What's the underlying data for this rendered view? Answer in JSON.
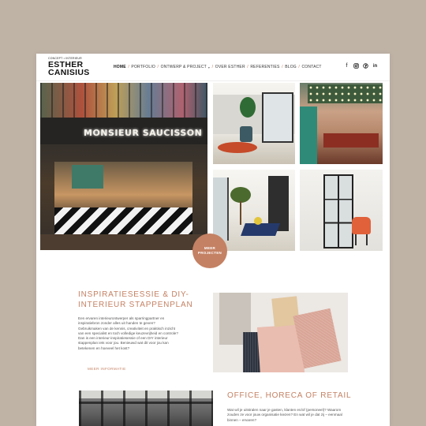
{
  "header": {
    "logo_tagline": "CONCEPT • INTERIEUR",
    "logo_line1": "ESTHER",
    "logo_line2": "CANISIUS",
    "nav": [
      {
        "label": "Home",
        "active": true
      },
      {
        "label": "Portfolio"
      },
      {
        "label": "Ontwerp & Project",
        "has_dropdown": true
      },
      {
        "label": "Over Esther"
      },
      {
        "label": "Referenties"
      },
      {
        "label": "Blog"
      },
      {
        "label": "Contact"
      }
    ],
    "social_icons": [
      "facebook-icon",
      "instagram-icon",
      "pinterest-icon",
      "linkedin-icon"
    ]
  },
  "gallery": {
    "main_sign_text": "MONSIEUR SAUCISSON",
    "more_button_line1": "MEER",
    "more_button_line2": "PROJECTEN"
  },
  "section1": {
    "title": "INSPIRATIESESSIE & DIY-INTERIEUR STAPPENPLAN",
    "body": "Een ervaren interieurontwerper als sparringpartner en inspiratiebron zonder alles uit handen te geven? Gebruikmaken van de kennis, creativiteit en praktisch inzicht van een specialist en toch volledige keuzevrijheid en controle? Dan is een interieur-inspiratiesessie of een DIY interieur stappenplan iets voor jou. Benieuwd wat dit voor jou kan betekenen en hoeveel het kost?",
    "link": "MEER INFORMATIE"
  },
  "section2": {
    "title": "OFFICE, HORECA OF RETAIL",
    "body": "Wat wil je uitstralen naar je gasten, klanten en/of (personeel)? Waarom zouden ze voor jouw organisatie kiezen? En wat wil je dat zij – eenmaal binnen – ervaren?"
  },
  "colors": {
    "background": "#bfb3a6",
    "accent": "#c48163",
    "text": "#555555"
  }
}
